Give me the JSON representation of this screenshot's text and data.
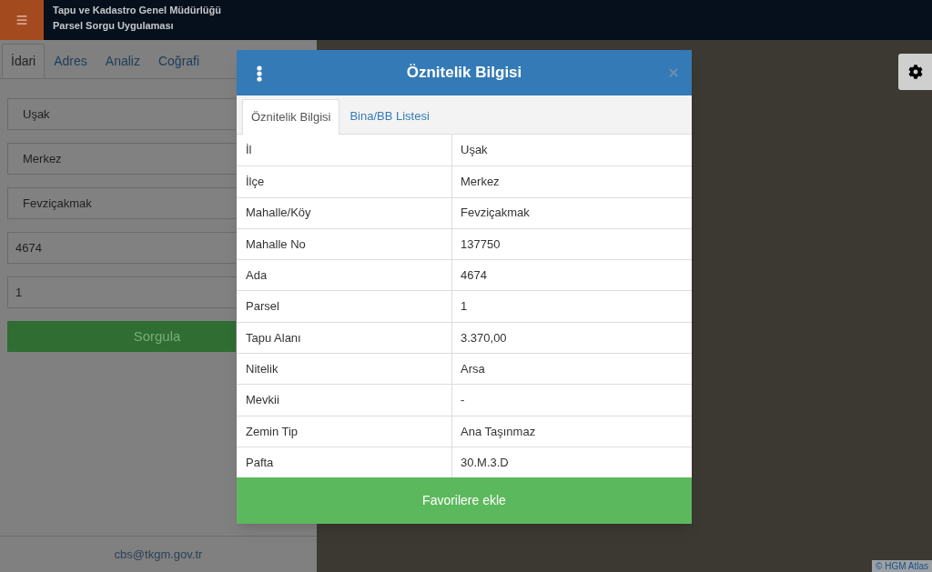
{
  "header": {
    "title": "Tapu ve Kadastro Genel Müdürlüğü",
    "subtitle": "Parsel Sorgu Uygulaması"
  },
  "sidebar": {
    "tabs": [
      {
        "label": "İdari",
        "selected": true
      },
      {
        "label": "Adres",
        "selected": false
      },
      {
        "label": "Analiz",
        "selected": false
      },
      {
        "label": "Coğrafi",
        "selected": false
      }
    ],
    "fields": [
      {
        "kind": "select",
        "value": "Uşak"
      },
      {
        "kind": "select",
        "value": "Merkez"
      },
      {
        "kind": "select",
        "value": "Fevziçakmak"
      },
      {
        "kind": "input",
        "value": "4674"
      },
      {
        "kind": "input",
        "value": "1"
      }
    ],
    "query_button": "Sorgula",
    "footer_link": "cbs@tkgm.gov.tr"
  },
  "map": {
    "attribution": "© HGM Atlas"
  },
  "dialog": {
    "title": "Öznitelik Bilgisi",
    "tabs": [
      {
        "label": "Öznitelik Bilgisi",
        "selected": true
      },
      {
        "label": "Bina/BB Listesi",
        "selected": false
      }
    ],
    "rows": [
      {
        "label": "İl",
        "value": "Uşak"
      },
      {
        "label": "İlçe",
        "value": "Merkez"
      },
      {
        "label": "Mahalle/Köy",
        "value": "Fevziçakmak"
      },
      {
        "label": "Mahalle No",
        "value": "137750"
      },
      {
        "label": "Ada",
        "value": "4674"
      },
      {
        "label": "Parsel",
        "value": "1"
      },
      {
        "label": "Tapu Alanı",
        "value": "3.370,00"
      },
      {
        "label": "Nitelik",
        "value": "Arsa"
      },
      {
        "label": "Mevkii",
        "value": "-"
      },
      {
        "label": "Zemin Tip",
        "value": "Ana Taşınmaz"
      },
      {
        "label": "Pafta",
        "value": "30.M.3.D"
      }
    ],
    "button": "Favorilere ekle"
  }
}
